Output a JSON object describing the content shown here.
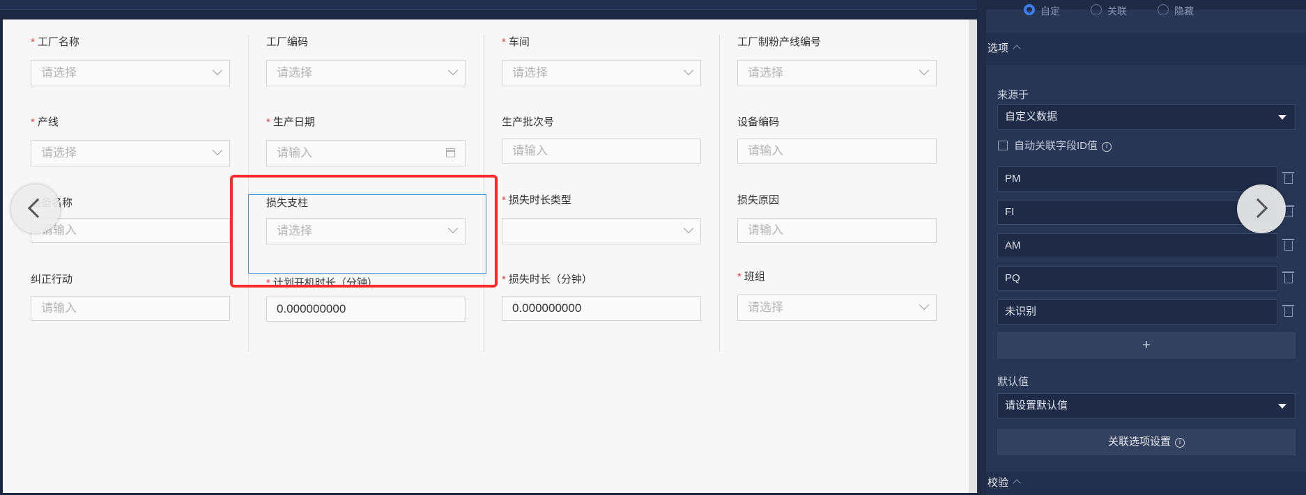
{
  "form": {
    "placeholders": {
      "select": "请选择",
      "input": "请输入"
    },
    "fields": [
      {
        "label": "工厂名称",
        "required": true,
        "type": "select"
      },
      {
        "label": "工厂编码",
        "required": false,
        "type": "select"
      },
      {
        "label": "车间",
        "required": true,
        "type": "select"
      },
      {
        "label": "工厂制粉产线编号",
        "required": false,
        "type": "select"
      },
      {
        "label": "产线",
        "required": true,
        "type": "select"
      },
      {
        "label": "生产日期",
        "required": true,
        "type": "date"
      },
      {
        "label": "生产批次号",
        "required": false,
        "type": "input"
      },
      {
        "label": "设备编码",
        "required": false,
        "type": "input"
      },
      {
        "label": "设备名称",
        "required": false,
        "type": "input"
      },
      {
        "label": "损失支柱",
        "required": false,
        "type": "select"
      },
      {
        "label": "损失时长类型",
        "required": true,
        "type": "select"
      },
      {
        "label": "损失原因",
        "required": false,
        "type": "input"
      },
      {
        "label": "纠正行动",
        "required": false,
        "type": "input"
      },
      {
        "label": "计划开机时长（分钟）",
        "required": true,
        "type": "number",
        "value": "0.000000000"
      },
      {
        "label": "损失时长（分钟）",
        "required": true,
        "type": "number",
        "value": "0.000000000"
      },
      {
        "label": "班组",
        "required": true,
        "type": "select"
      }
    ]
  },
  "panel": {
    "top_radios": [
      "自定",
      "关联",
      "隐藏"
    ],
    "options_section": "选项",
    "source_label": "来源于",
    "source_value": "自定义数据",
    "auto_link_label": "自动关联字段ID值",
    "options": [
      "PM",
      "FI",
      "AM",
      "PQ",
      "未识别"
    ],
    "add_symbol": "+",
    "default_label": "默认值",
    "default_placeholder": "请设置默认值",
    "link_settings_button": "关联选项设置",
    "validation_section": "校验",
    "info_glyph": "i"
  },
  "colors": {
    "accent": "#3f7cf2",
    "required": "#e23b3b",
    "annotation": "#ff2a2a",
    "selection": "#4a90e2"
  }
}
